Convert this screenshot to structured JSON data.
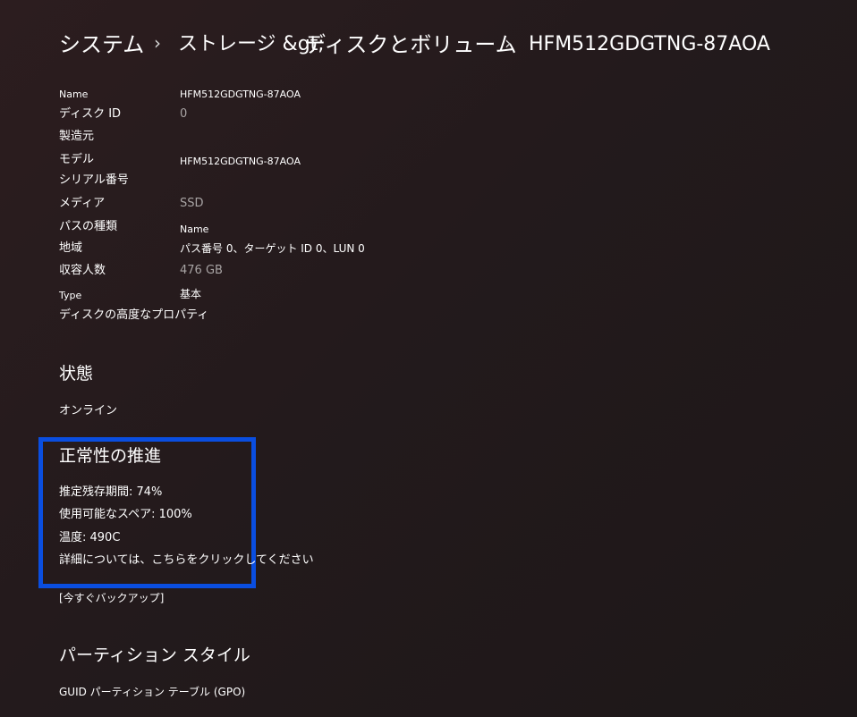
{
  "breadcrumb": {
    "items": [
      "システム",
      "ストレージ &gt;",
      "ディスクとボリューム",
      "HFM512GDGTNG-87AOA"
    ],
    "separator": "›"
  },
  "properties": [
    {
      "label": "Name",
      "value": "HFM512GDGTNG-87AOA"
    },
    {
      "label": "ディスク ID",
      "value": "0"
    },
    {
      "label": "製造元",
      "value": ""
    },
    {
      "label": "モデル",
      "value": "HFM512GDGTNG-87AOA"
    },
    {
      "label": "シリアル番号",
      "value": ""
    },
    {
      "label": "メディア",
      "value": "SSD"
    },
    {
      "label": "パスの種類",
      "value": "Name"
    },
    {
      "label": "地域",
      "value": "パス番号 0、ターゲット ID 0、LUN 0"
    },
    {
      "label": "収容人数",
      "value": "476 GB"
    },
    {
      "label": "Type",
      "value": "基本"
    }
  ],
  "advanced_link": "ディスクの高度なプロパティ",
  "status": {
    "title": "状態",
    "value": "オンライン"
  },
  "health": {
    "title": "正常性の推進",
    "lines": [
      "推定残存期間: 74%",
      "使用可能なスペア: 100%",
      "温度: 490C"
    ],
    "details_link": "詳細については、こちらをクリックしてください",
    "highlight_color": "#0a4ee0"
  },
  "backup_link": "[今すぐバックアップ]",
  "partition": {
    "title": "パーティション スタイル",
    "value": "GUID パーティション テーブル (GPO)"
  }
}
